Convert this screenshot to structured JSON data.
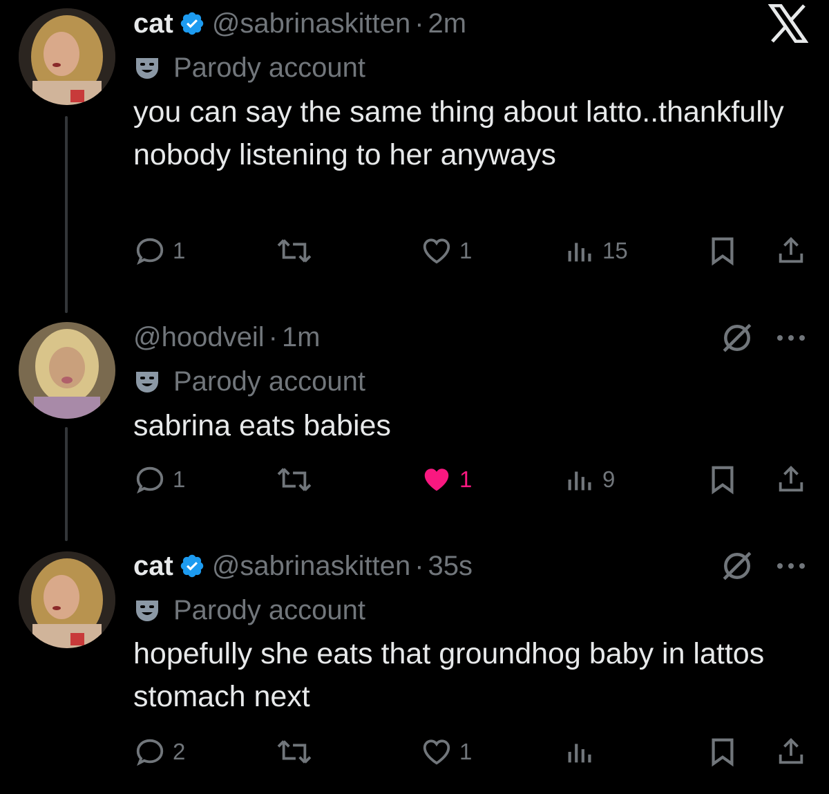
{
  "x_logo": "X",
  "colors": {
    "background": "#000000",
    "text": "#e7e9ea",
    "muted": "#71767b",
    "verified": "#1d9bf0",
    "like": "#f91880"
  },
  "tweets": [
    {
      "name": "cat",
      "verified": true,
      "handle": "@sabrinaskitten",
      "separator": "·",
      "time": "2m",
      "badge": "Parody account",
      "text": "you can say the same thing about latto..thankfully nobody listening to her anyways",
      "replies": "1",
      "retweets": "",
      "likes": "1",
      "liked": false,
      "views": "15"
    },
    {
      "name": "",
      "verified": false,
      "handle": "@hoodveil",
      "separator": "·",
      "time": "1m",
      "badge": "Parody account",
      "text": "sabrina eats babies",
      "replies": "1",
      "retweets": "",
      "likes": "1",
      "liked": true,
      "views": "9"
    },
    {
      "name": "cat",
      "verified": true,
      "handle": "@sabrinaskitten",
      "separator": "·",
      "time": "35s",
      "badge": "Parody account",
      "text": "hopefully she eats that groundhog baby in lattos stomach next",
      "replies": "2",
      "retweets": "",
      "likes": "1",
      "liked": false,
      "views": ""
    }
  ]
}
